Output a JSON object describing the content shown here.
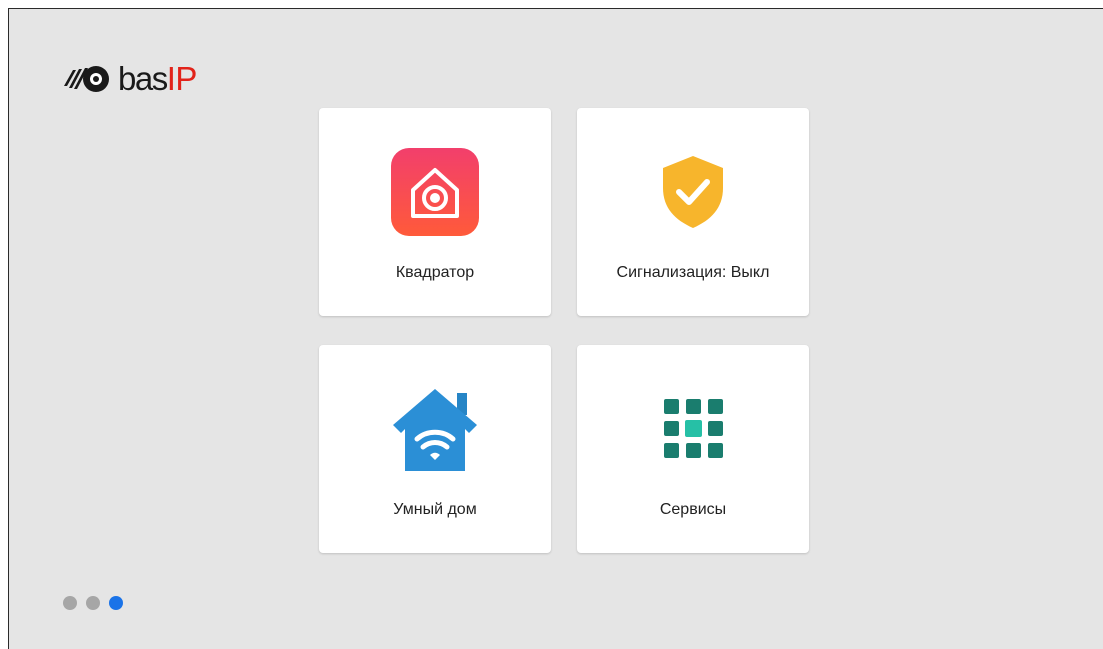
{
  "brand": {
    "logo_text_main": "bas",
    "logo_text_accent": "IP",
    "logo_icon": "basip-logo-icon"
  },
  "tiles": [
    {
      "label": "Квадратор",
      "icon": "quad-camera-icon"
    },
    {
      "label": "Сигнализация: Выкл",
      "icon": "shield-check-icon"
    },
    {
      "label": "Умный дом",
      "icon": "smart-home-icon"
    },
    {
      "label": "Сервисы",
      "icon": "services-grid-icon"
    }
  ],
  "pager": {
    "total": 3,
    "active": 3
  },
  "colors": {
    "background": "#e5e5e5",
    "tile": "#ffffff",
    "dot_active": "#1a73e8",
    "dot_inactive": "#a6a6a6",
    "brand_red": "#e2231a"
  }
}
